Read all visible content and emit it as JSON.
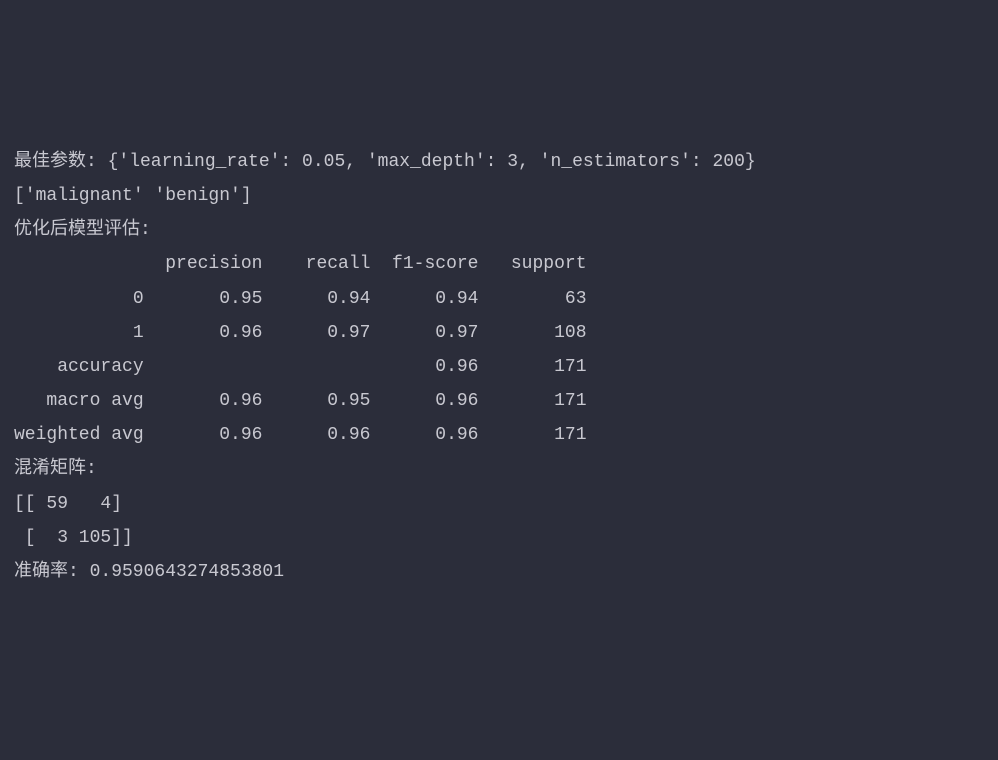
{
  "lines": {
    "best_params": "最佳参数: {'learning_rate': 0.05, 'max_depth': 3, 'n_estimators': 200}",
    "classes": "['malignant' 'benign']",
    "eval_header": "优化后模型评估:",
    "report_header": "              precision    recall  f1-score   support",
    "blank1": "",
    "class_0": "           0       0.95      0.94      0.94        63",
    "class_1": "           1       0.96      0.97      0.97       108",
    "blank2": "",
    "accuracy": "    accuracy                           0.96       171",
    "macro_avg": "   macro avg       0.96      0.95      0.96       171",
    "weighted_avg": "weighted avg       0.96      0.96      0.96       171",
    "blank3": "",
    "cm_header": "混淆矩阵:",
    "cm_row1": "[[ 59   4]",
    "cm_row2": " [  3 105]]",
    "accuracy_score": "准确率: 0.9590643274853801"
  },
  "chart_data": {
    "type": "table",
    "title": "Classification Report",
    "best_params": {
      "learning_rate": 0.05,
      "max_depth": 3,
      "n_estimators": 200
    },
    "classes": [
      "malignant",
      "benign"
    ],
    "report": {
      "columns": [
        "precision",
        "recall",
        "f1-score",
        "support"
      ],
      "rows": [
        {
          "label": "0",
          "precision": 0.95,
          "recall": 0.94,
          "f1-score": 0.94,
          "support": 63
        },
        {
          "label": "1",
          "precision": 0.96,
          "recall": 0.97,
          "f1-score": 0.97,
          "support": 108
        },
        {
          "label": "accuracy",
          "precision": null,
          "recall": null,
          "f1-score": 0.96,
          "support": 171
        },
        {
          "label": "macro avg",
          "precision": 0.96,
          "recall": 0.95,
          "f1-score": 0.96,
          "support": 171
        },
        {
          "label": "weighted avg",
          "precision": 0.96,
          "recall": 0.96,
          "f1-score": 0.96,
          "support": 171
        }
      ]
    },
    "confusion_matrix": [
      [
        59,
        4
      ],
      [
        3,
        105
      ]
    ],
    "accuracy_score": 0.9590643274853801
  }
}
